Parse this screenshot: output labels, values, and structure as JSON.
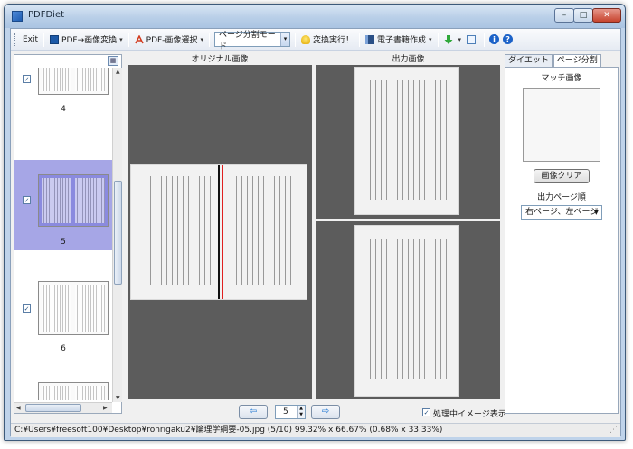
{
  "window": {
    "title": "PDFDiet",
    "min": "–",
    "max": "□",
    "close": "✕"
  },
  "toolbar": {
    "exit": "Exit",
    "pdf_to_image": "PDF→画像変換",
    "pdf_image_select": "PDF-画像選択",
    "mode_value": "ページ分割モード",
    "run": "変換実行！",
    "ebook": "電子書籍作成",
    "dd": "▾"
  },
  "thumbs": {
    "items": [
      {
        "label": "4",
        "checked": "✓"
      },
      {
        "label": "5",
        "checked": "✓"
      },
      {
        "label": "6",
        "checked": "✓"
      },
      {
        "label": "",
        "checked": "✓"
      }
    ]
  },
  "panels": {
    "original_label": "オリジナル画像",
    "output_label": "出力画像"
  },
  "nav": {
    "page": "5",
    "prev": "⇦",
    "next": "⇨",
    "preview_check": "✓",
    "preview_label": "処理中イメージ表示"
  },
  "sidebar": {
    "tabs": [
      "ダイエット",
      "ページ分割"
    ],
    "match_label": "マッチ画像",
    "clear_button": "画像クリア",
    "order_label": "出力ページ順",
    "order_value": "右ページ、左ページ",
    "order_arrow": "▼"
  },
  "status": {
    "text": "C:¥Users¥freesoft100¥Desktop¥ronrigaku2¥論理学綱要-05.jpg (5/10)  99.32% x 66.67% (0.68% x 33.33%)"
  },
  "colors": {
    "selection": "#a6a6e6",
    "split_line": "#e02020",
    "panel": "#5c5c5c"
  }
}
